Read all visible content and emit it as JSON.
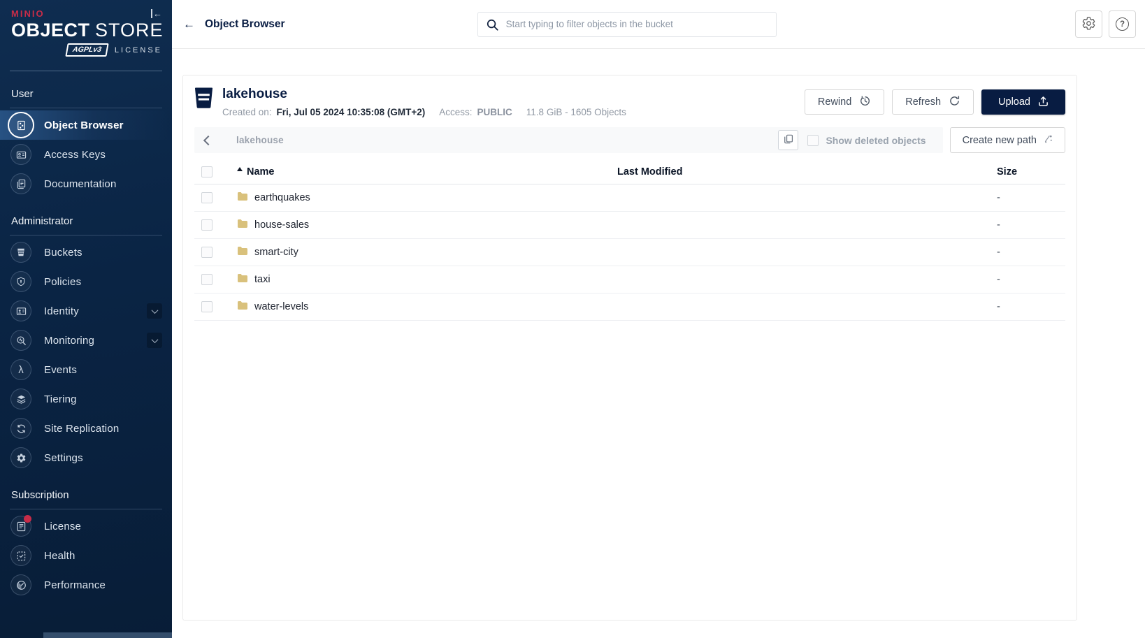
{
  "icons": {
    "back": "←",
    "collapse": "←",
    "help": "?",
    "lambda": "λ"
  },
  "colors": {
    "accent_red": "#c72c48",
    "navy": "#081c42",
    "folder": "#d9c17c"
  },
  "sidebar": {
    "brand": {
      "name": "MINIO",
      "product_bold": "OBJECT",
      "product_light": "STORE",
      "license_badge": "AGPLv3",
      "license_label": "LICENSE"
    },
    "sections": [
      {
        "label": "User",
        "items": [
          {
            "label": "Object Browser",
            "icon": "object-browser-icon",
            "active": true
          },
          {
            "label": "Access Keys",
            "icon": "access-keys-icon",
            "active": false
          },
          {
            "label": "Documentation",
            "icon": "documentation-icon",
            "active": false
          }
        ]
      },
      {
        "label": "Administrator",
        "items": [
          {
            "label": "Buckets",
            "icon": "buckets-icon"
          },
          {
            "label": "Policies",
            "icon": "policies-icon"
          },
          {
            "label": "Identity",
            "icon": "identity-icon",
            "expandable": true
          },
          {
            "label": "Monitoring",
            "icon": "monitoring-icon",
            "expandable": true
          },
          {
            "label": "Events",
            "icon": "events-icon"
          },
          {
            "label": "Tiering",
            "icon": "tiering-icon"
          },
          {
            "label": "Site Replication",
            "icon": "site-replication-icon"
          },
          {
            "label": "Settings",
            "icon": "settings-icon"
          }
        ]
      },
      {
        "label": "Subscription",
        "items": [
          {
            "label": "License",
            "icon": "license-icon",
            "badge": true
          },
          {
            "label": "Health",
            "icon": "health-icon"
          },
          {
            "label": "Performance",
            "icon": "performance-icon"
          }
        ]
      }
    ]
  },
  "header": {
    "title": "Object Browser",
    "search_placeholder": "Start typing to filter objects in the bucket"
  },
  "bucket": {
    "name": "lakehouse",
    "created_label": "Created on:",
    "created_value": "Fri, Jul 05 2024 10:35:08 (GMT+2)",
    "access_label": "Access:",
    "access_value": "PUBLIC",
    "usage": "11.8 GiB - 1605 Objects",
    "buttons": {
      "rewind": "Rewind",
      "refresh": "Refresh",
      "upload": "Upload"
    }
  },
  "pathbar": {
    "path": "lakehouse",
    "show_deleted_label": "Show deleted objects",
    "create_path_label": "Create new path"
  },
  "table": {
    "columns": [
      "Name",
      "Last Modified",
      "Size"
    ],
    "rows": [
      {
        "name": "earthquakes",
        "last_modified": "",
        "size": "-"
      },
      {
        "name": "house-sales",
        "last_modified": "",
        "size": "-"
      },
      {
        "name": "smart-city",
        "last_modified": "",
        "size": "-"
      },
      {
        "name": "taxi",
        "last_modified": "",
        "size": "-"
      },
      {
        "name": "water-levels",
        "last_modified": "",
        "size": "-"
      }
    ]
  }
}
